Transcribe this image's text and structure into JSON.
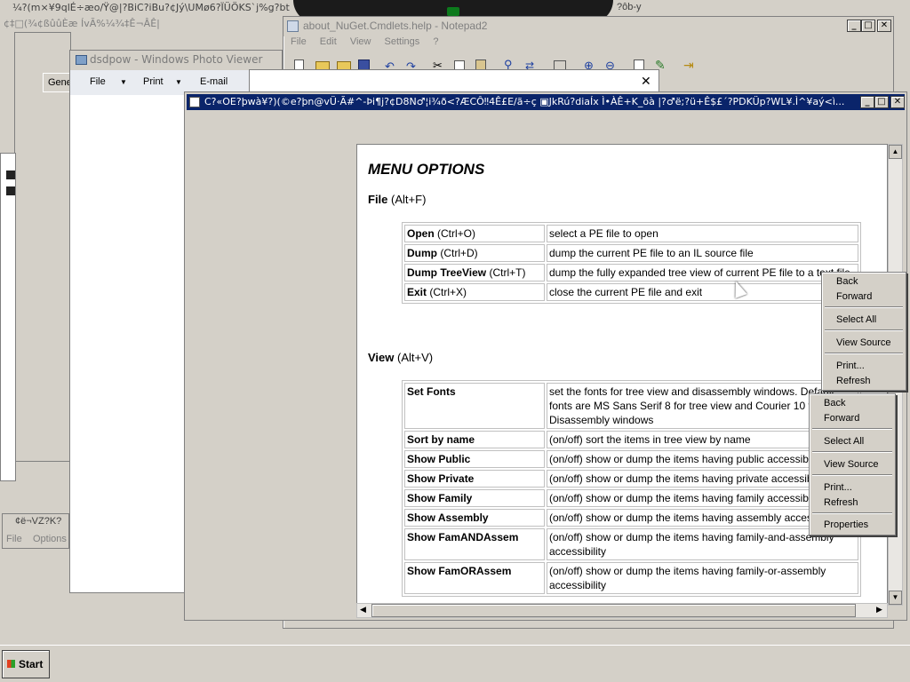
{
  "background": {
    "top_garble": "¼?(m×¥9qlÉ÷æo/Ÿ@|?BiC?iBu?¢Jý\\UMø6?ÏÜÖKS`j%g?bt",
    "row2_garble": "¢‡□(¾¢ßûûÈæ ÍvÃ%¼¾‡Ê¬ÂÊ|",
    "right_garble": "?ôb-y",
    "left_tab": "Gene",
    "left_small_title": "¢ë¬VZ?K?",
    "left_small_menus": [
      "File",
      "Options"
    ]
  },
  "photo_viewer": {
    "title": "dsdpow - Windows Photo Viewer",
    "menus": [
      "File",
      "Print",
      "E-mail"
    ]
  },
  "notepad": {
    "title": "about_NuGet.Cmdlets.help - Notepad2",
    "menus": [
      "File",
      "Edit",
      "View",
      "Settings",
      "?"
    ]
  },
  "dialog": {
    "close_glyph": "✕"
  },
  "help_window": {
    "title": "C?«OE?þwà¥?)(©e?þn@vÜ·Ã#^-Þi¶j?¢D8N♂¦i¾ð<?ÆCÔ‼4Ê£E/ã÷ç ▣JkRú?diaÍx Ì•ÀÊ+K_õà |?♂ë;?ü+Ê$£´?PDKÜp?WL¥.Ì^¥aý<ì...",
    "heading": "MENU OPTIONS",
    "file_section": {
      "name": "File",
      "shortcut": "(Alt+F)"
    },
    "file_rows": [
      {
        "cmd": "Open",
        "keys": "(Ctrl+O)",
        "desc": "select a PE file to open"
      },
      {
        "cmd": "Dump",
        "keys": "(Ctrl+D)",
        "desc": "dump the current PE file to an IL source file"
      },
      {
        "cmd": "Dump TreeView",
        "keys": "(Ctrl+T)",
        "desc": "dump the fully expanded tree view of current PE file to a text file"
      },
      {
        "cmd": "Exit",
        "keys": "(Ctrl+X)",
        "desc": "close the current PE file and exit"
      }
    ],
    "view_section": {
      "name": "View",
      "shortcut": "(Alt+V)"
    },
    "view_rows": [
      {
        "cmd": "Set Fonts",
        "desc": "set the fonts for tree view and disassembly windows. Default fonts are MS Sans Serif 8 for tree view and Courier 10 for Disassembly windows"
      },
      {
        "cmd": "Sort by name",
        "desc": "(on/off) sort the items in tree view by name"
      },
      {
        "cmd": "Show Public",
        "desc": "(on/off) show or dump the items having public accessibility"
      },
      {
        "cmd": "Show Private",
        "desc": "(on/off) show or dump the items having private accessibility"
      },
      {
        "cmd": "Show Family",
        "desc": "(on/off) show or dump the items having family accessibility"
      },
      {
        "cmd": "Show Assembly",
        "desc": "(on/off) show or dump the items having assembly accessibility"
      },
      {
        "cmd": "Show FamANDAssem",
        "desc": "(on/off) show or dump the items having family-and-assembly accessibility"
      },
      {
        "cmd": "Show FamORAssem",
        "desc": "(on/off) show or dump the items having family-or-assembly accessibility"
      }
    ]
  },
  "context_menu_1": {
    "items": [
      "Back",
      "Forward",
      "Select All",
      "View Source",
      "Print...",
      "Refresh"
    ]
  },
  "context_menu_2": {
    "items": [
      "Back",
      "Forward",
      "Select All",
      "View Source",
      "Print...",
      "Refresh",
      "Properties"
    ]
  },
  "taskbar": {
    "start_label": "Start"
  }
}
